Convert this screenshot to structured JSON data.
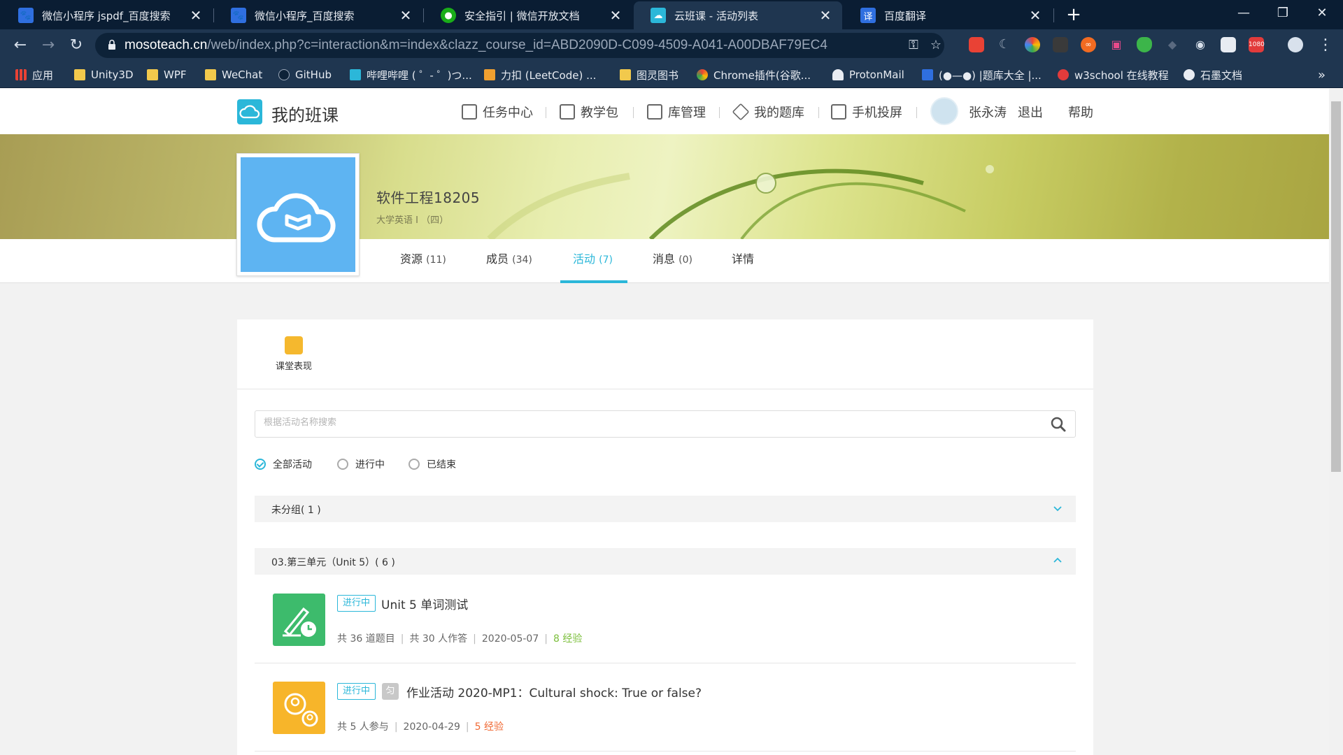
{
  "browser": {
    "tabs": [
      {
        "title": "微信小程序 jspdf_百度搜索",
        "icon": "baidu-paw-icon",
        "active": false
      },
      {
        "title": "微信小程序_百度搜索",
        "icon": "baidu-paw-icon",
        "active": false
      },
      {
        "title": "安全指引 | 微信开放文档",
        "icon": "wechat-icon",
        "active": false
      },
      {
        "title": "云班课 - 活动列表",
        "icon": "mosoteach-icon",
        "active": true
      },
      {
        "title": "百度翻译",
        "icon": "baidu-translate-icon",
        "active": false
      }
    ],
    "url_domain": "mosoteach.cn",
    "url_path": "/web/index.php?c=interaction&m=index&clazz_course_id=ABD2090D-C099-4509-A041-A00DBAF79EC4",
    "bookmarks": [
      "应用",
      "Unity3D",
      "WPF",
      "WeChat",
      "GitHub",
      "哔哩哔哩 ( ゜- ゜)つ...",
      "力扣 (LeetCode) ...",
      "图灵图书",
      "Chrome插件(谷歌...",
      "ProtonMail",
      "(●—●) |题库大全 |...",
      "w3school 在线教程",
      "石墨文档"
    ],
    "more_bookmarks": "»",
    "ext_1080_label": "1080",
    "translate_fav": "译"
  },
  "header": {
    "logo_text": "我的班课",
    "nav": [
      "任务中心",
      "教学包",
      "库管理",
      "我的题库",
      "手机投屏"
    ],
    "username": "张永涛",
    "logout": "退出",
    "help": "帮助"
  },
  "course": {
    "name": "软件工程18205",
    "subtitle": "大学英语 I （四）",
    "tabs": [
      {
        "label": "资源",
        "count": "(11)"
      },
      {
        "label": "成员",
        "count": "(34)"
      },
      {
        "label": "活动",
        "count": "(7)"
      },
      {
        "label": "消息",
        "count": "(0)"
      },
      {
        "label": "详情",
        "count": ""
      }
    ]
  },
  "activities": {
    "perf_label": "课堂表现",
    "search_placeholder": "根据活动名称搜索",
    "filters": [
      "全部活动",
      "进行中",
      "已结束"
    ],
    "selected_filter": "全部活动",
    "groups": [
      {
        "label": "未分组( 1 )",
        "expanded": false
      },
      {
        "label": "03.第三单元（Unit 5）( 6 )",
        "expanded": true
      }
    ],
    "items": [
      {
        "status": "进行中",
        "title": "Unit 5 单词测试",
        "meta": [
          "共 36 道题目",
          "共 30 人作答",
          "2020-05-07"
        ],
        "exp": "8 经验",
        "exp_color": "#7cbf3c",
        "icon": "quiz-icon",
        "icon_color": "#3dbb6c"
      },
      {
        "status": "进行中",
        "extra_badge": "匀",
        "title": "作业活动 2020-MP1：Cultural shock: True or false?",
        "meta": [
          "共 5 人参与",
          "2020-04-29"
        ],
        "exp": "5 经验",
        "exp_color": "#f06a35",
        "icon": "homework-icon",
        "icon_color": "#f7b52a"
      }
    ]
  },
  "colors": {
    "accent": "#2bb7d9",
    "chrome_dark": "#0a1d33",
    "chrome": "#1f3650"
  }
}
